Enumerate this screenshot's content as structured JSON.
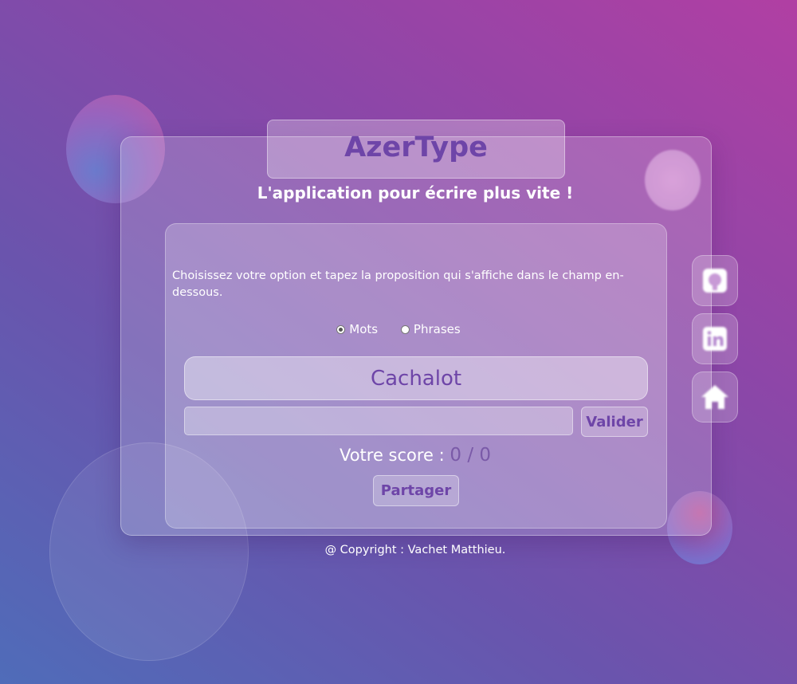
{
  "header": {
    "title": "AzerType",
    "subtitle": "L'application pour écrire plus vite !"
  },
  "main": {
    "instruction": "Choisissez votre option et tapez la proposition qui s'affiche dans le champ en-dessous.",
    "options": [
      {
        "label": "Mots",
        "checked": true
      },
      {
        "label": "Phrases",
        "checked": false
      }
    ],
    "proposal": "Cachalot",
    "input": {
      "value": "",
      "placeholder": ""
    },
    "validate_label": "Valider",
    "score": {
      "label": "Votre score :",
      "value": "0 / 0"
    },
    "share_label": "Partager"
  },
  "footer": {
    "text": "@ Copyright : Vachet Matthieu."
  },
  "social": [
    {
      "icon": "github-icon"
    },
    {
      "icon": "linkedin-icon"
    },
    {
      "icon": "home-icon"
    }
  ],
  "colors": {
    "accent": "#6e45a8",
    "bg_start": "#4f6cb9",
    "bg_end": "#b13fa3"
  }
}
